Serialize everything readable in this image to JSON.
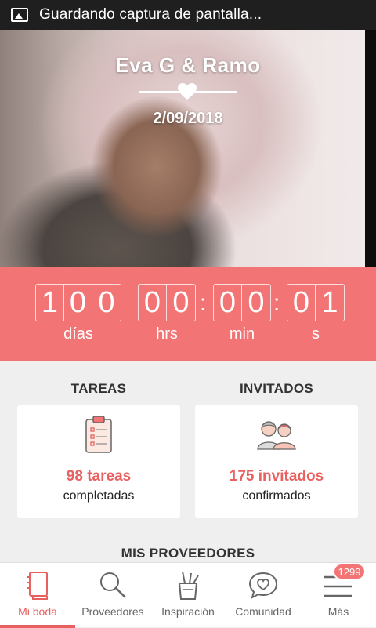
{
  "status_bar": {
    "text": "Guardando captura de pantalla..."
  },
  "hero": {
    "names": "Eva G & Ramo",
    "date": "2/09/2018"
  },
  "countdown": {
    "days": [
      "1",
      "0",
      "0"
    ],
    "hours": [
      "0",
      "0"
    ],
    "minutes": [
      "0",
      "0"
    ],
    "seconds": [
      "0",
      "1"
    ],
    "labels": {
      "days": "días",
      "hours": "hrs",
      "minutes": "min",
      "seconds": "s"
    },
    "colon": ":"
  },
  "sections": {
    "tasks_title": "TAREAS",
    "guests_title": "INVITADOS",
    "vendors_title": "MIS PROVEEDORES"
  },
  "cards": {
    "tasks": {
      "main": "98 tareas",
      "sub": "completadas",
      "icon": "clipboard-icon"
    },
    "guests": {
      "main": "175 invitados",
      "sub": "confirmados",
      "icon": "couple-icon"
    }
  },
  "tabs": [
    {
      "label": "Mi boda",
      "icon": "notebook-icon",
      "active": true
    },
    {
      "label": "Proveedores",
      "icon": "search-icon",
      "active": false
    },
    {
      "label": "Inspiración",
      "icon": "brushes-icon",
      "active": false
    },
    {
      "label": "Comunidad",
      "icon": "chat-heart-icon",
      "active": false
    },
    {
      "label": "Más",
      "icon": "menu-icon",
      "active": false
    }
  ],
  "badge": "1299",
  "colors": {
    "accent": "#e8605f",
    "countdown_bg": "#f27474",
    "page_bg": "#efefef"
  }
}
